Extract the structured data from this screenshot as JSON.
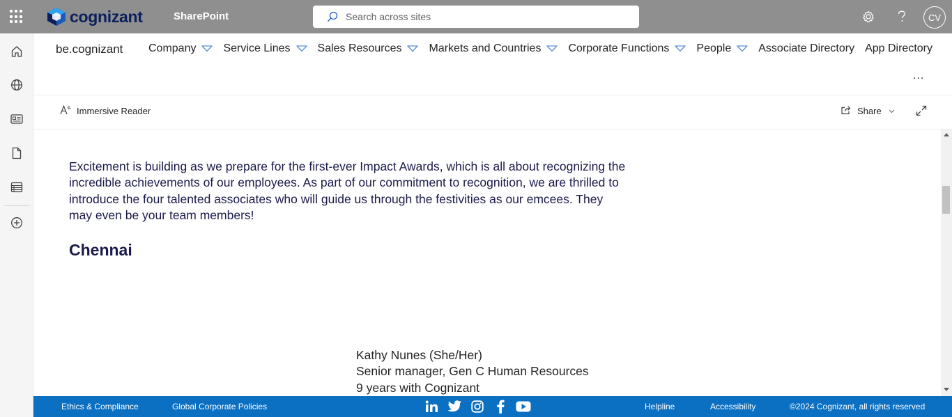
{
  "topbar": {
    "logo_text": "cognizant",
    "app_name": "SharePoint",
    "search_placeholder": "Search across sites",
    "avatar_initials": "CV",
    "icons": [
      "app-launcher-icon",
      "settings-icon",
      "help-icon"
    ]
  },
  "left_rail": {
    "items": [
      "home-icon",
      "globe-icon",
      "news-icon",
      "document-icon",
      "list-icon",
      "create-icon"
    ]
  },
  "site_nav": {
    "site_title": "be.cognizant",
    "items": [
      {
        "label": "Company",
        "has_dropdown": true
      },
      {
        "label": "Service Lines",
        "has_dropdown": true
      },
      {
        "label": "Sales Resources",
        "has_dropdown": true
      },
      {
        "label": "Markets and Countries",
        "has_dropdown": true
      },
      {
        "label": "Corporate Functions",
        "has_dropdown": true
      },
      {
        "label": "People",
        "has_dropdown": true
      },
      {
        "label": "Associate Directory",
        "has_dropdown": false
      },
      {
        "label": "App Directory",
        "has_dropdown": false
      }
    ],
    "more_label": "..."
  },
  "command_bar": {
    "immersive_reader": "Immersive Reader",
    "share": "Share"
  },
  "article": {
    "paragraph": "Excitement is building as we prepare for the first-ever Impact Awards, which is all about recognizing the incredible achievements of our employees. As part of our commitment to recognition, we are thrilled to introduce the four talented associates who will guide us through the festivities as our emcees. They may even be your team members!",
    "heading": "Chennai",
    "person": {
      "name": "Kathy Nunes (She/Her)",
      "title": "Senior manager, Gen C Human Resources",
      "tenure": "9 years with Cognizant"
    }
  },
  "footer": {
    "ethics": "Ethics & Compliance",
    "policies": "Global Corporate Policies",
    "helpline": "Helpline",
    "accessibility": "Accessibility",
    "copyright": "©2024 Cognizant, all rights reserved",
    "social": [
      "linkedin-icon",
      "twitter-icon",
      "instagram-icon",
      "facebook-icon",
      "youtube-icon"
    ]
  },
  "colors": {
    "topbar_bg": "#8f8f8f",
    "footer_bg": "#0b6fc2",
    "heading_text": "#1b1a4a",
    "dropdown_chevron": "#5b8fd6"
  }
}
